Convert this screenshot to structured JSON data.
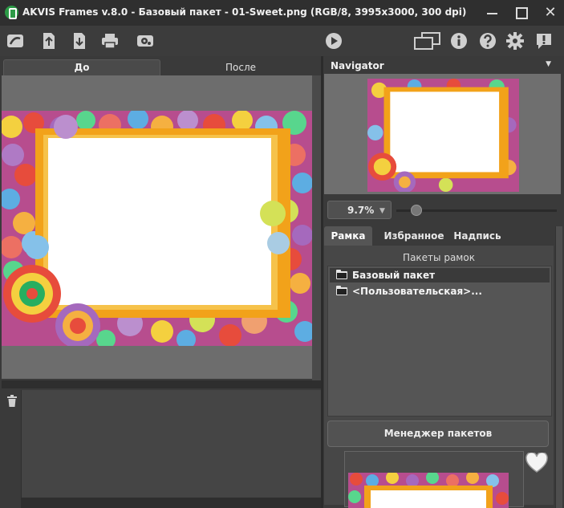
{
  "window": {
    "title": "AKVIS Frames v.8.0 - Базовый пакет - 01-Sweet.png (RGB/8, 3995x3000, 300 dpi)"
  },
  "toolbar": {
    "icons": [
      "home-icon",
      "open-icon",
      "save-icon",
      "print-icon",
      "settings-batch-icon",
      "run-icon",
      "workspace-icon",
      "info-icon",
      "help-icon",
      "gear-icon",
      "feedback-icon"
    ]
  },
  "left_tabs": {
    "before": "До",
    "after": "После"
  },
  "navigator": {
    "title": "Navigator",
    "zoom": "9.7%"
  },
  "right_tabs": {
    "frame": "Рамка",
    "favorites": "Избранное",
    "caption": "Надпись"
  },
  "packs": {
    "title": "Пакеты рамок",
    "items": [
      {
        "label": "Базовый пакет"
      },
      {
        "label": "<Пользовательская>..."
      }
    ],
    "manager_button": "Менеджер пакетов"
  },
  "colors": {
    "accent_frame": "#f2a21a",
    "background": "#3a3a3a"
  }
}
